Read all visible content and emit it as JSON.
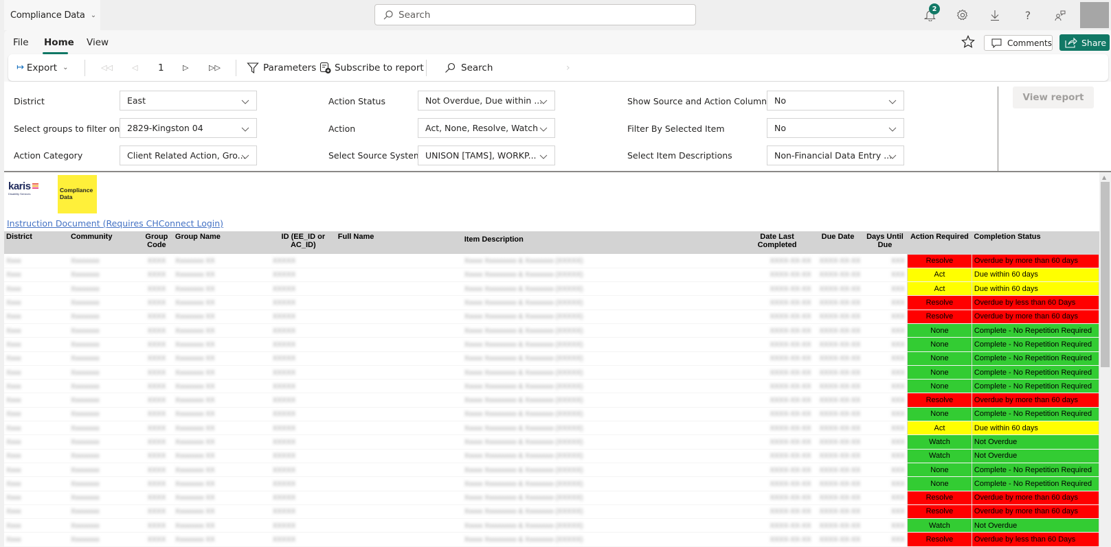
{
  "app": {
    "title": "Compliance Data"
  },
  "top_search": {
    "placeholder": "Search"
  },
  "notifications": {
    "count": "2"
  },
  "menu": {
    "tabs": [
      "File",
      "Home",
      "View"
    ],
    "active": "Home"
  },
  "actions": {
    "comments": "Comments",
    "share": "Share"
  },
  "toolbar": {
    "export": "Export",
    "page": "1",
    "parameters": "Parameters",
    "subscribe": "Subscribe to report",
    "search": "Search"
  },
  "params": [
    {
      "label": "District",
      "value": "East"
    },
    {
      "label": "Select groups to filter on:",
      "value": "2829-Kingston 04"
    },
    {
      "label": "Action Category",
      "value": "Client Related Action, Gro..."
    },
    {
      "label": "Action Status",
      "value": "Not Overdue, Due within ..."
    },
    {
      "label": "Action",
      "value": "Act, None, Resolve, Watch"
    },
    {
      "label": "Select Source System",
      "value": "UNISON [TAMS], WORKP..."
    },
    {
      "label": "Show Source and Action Columns",
      "value": "No"
    },
    {
      "label": "Filter By Selected Item",
      "value": "No"
    },
    {
      "label": "Select Item Descriptions",
      "value": "Non-Financial Data Entry ..."
    }
  ],
  "view_report": "View report",
  "report": {
    "logo_word": "karis",
    "logo_sub": "Disability Services",
    "badge_text": "Compliance Data",
    "instruction_link": "Instruction Document (Requires CHConnect Login)",
    "columns": [
      "District",
      "Community",
      "Group Code",
      "Group Name",
      "ID (EE_ID or AC_ID)",
      "Full Name",
      "Item Description",
      "Date Last Completed",
      "Due Date",
      "Days Until Due",
      "Action Required",
      "Completion Status"
    ],
    "status_colors": {
      "Resolve": "#ff0000",
      "Act": "#ffff00",
      "None": "#33cc33",
      "Watch": "#33cc33"
    },
    "rows": [
      {
        "action": "Resolve",
        "status": "Overdue by more than 60 days"
      },
      {
        "action": "Act",
        "status": "Due within 60 days"
      },
      {
        "action": "Act",
        "status": "Due within 60 days"
      },
      {
        "action": "Resolve",
        "status": "Overdue by less than 60 Days"
      },
      {
        "action": "Resolve",
        "status": "Overdue by more than 60 days"
      },
      {
        "action": "None",
        "status": "Complete - No Repetition Required"
      },
      {
        "action": "None",
        "status": "Complete - No Repetition Required"
      },
      {
        "action": "None",
        "status": "Complete - No Repetition Required"
      },
      {
        "action": "None",
        "status": "Complete - No Repetition Required"
      },
      {
        "action": "None",
        "status": "Complete - No Repetition Required"
      },
      {
        "action": "Resolve",
        "status": "Overdue by more than 60 days"
      },
      {
        "action": "None",
        "status": "Complete - No Repetition Required"
      },
      {
        "action": "Act",
        "status": "Due within 60 days"
      },
      {
        "action": "Watch",
        "status": "Not Overdue"
      },
      {
        "action": "Watch",
        "status": "Not Overdue"
      },
      {
        "action": "None",
        "status": "Complete - No Repetition Required"
      },
      {
        "action": "None",
        "status": "Complete - No Repetition Required"
      },
      {
        "action": "Resolve",
        "status": "Overdue by more than 60 days"
      },
      {
        "action": "Resolve",
        "status": "Overdue by more than 60 days"
      },
      {
        "action": "Watch",
        "status": "Not Overdue"
      },
      {
        "action": "Resolve",
        "status": "Overdue by less than 60 Days"
      }
    ]
  }
}
